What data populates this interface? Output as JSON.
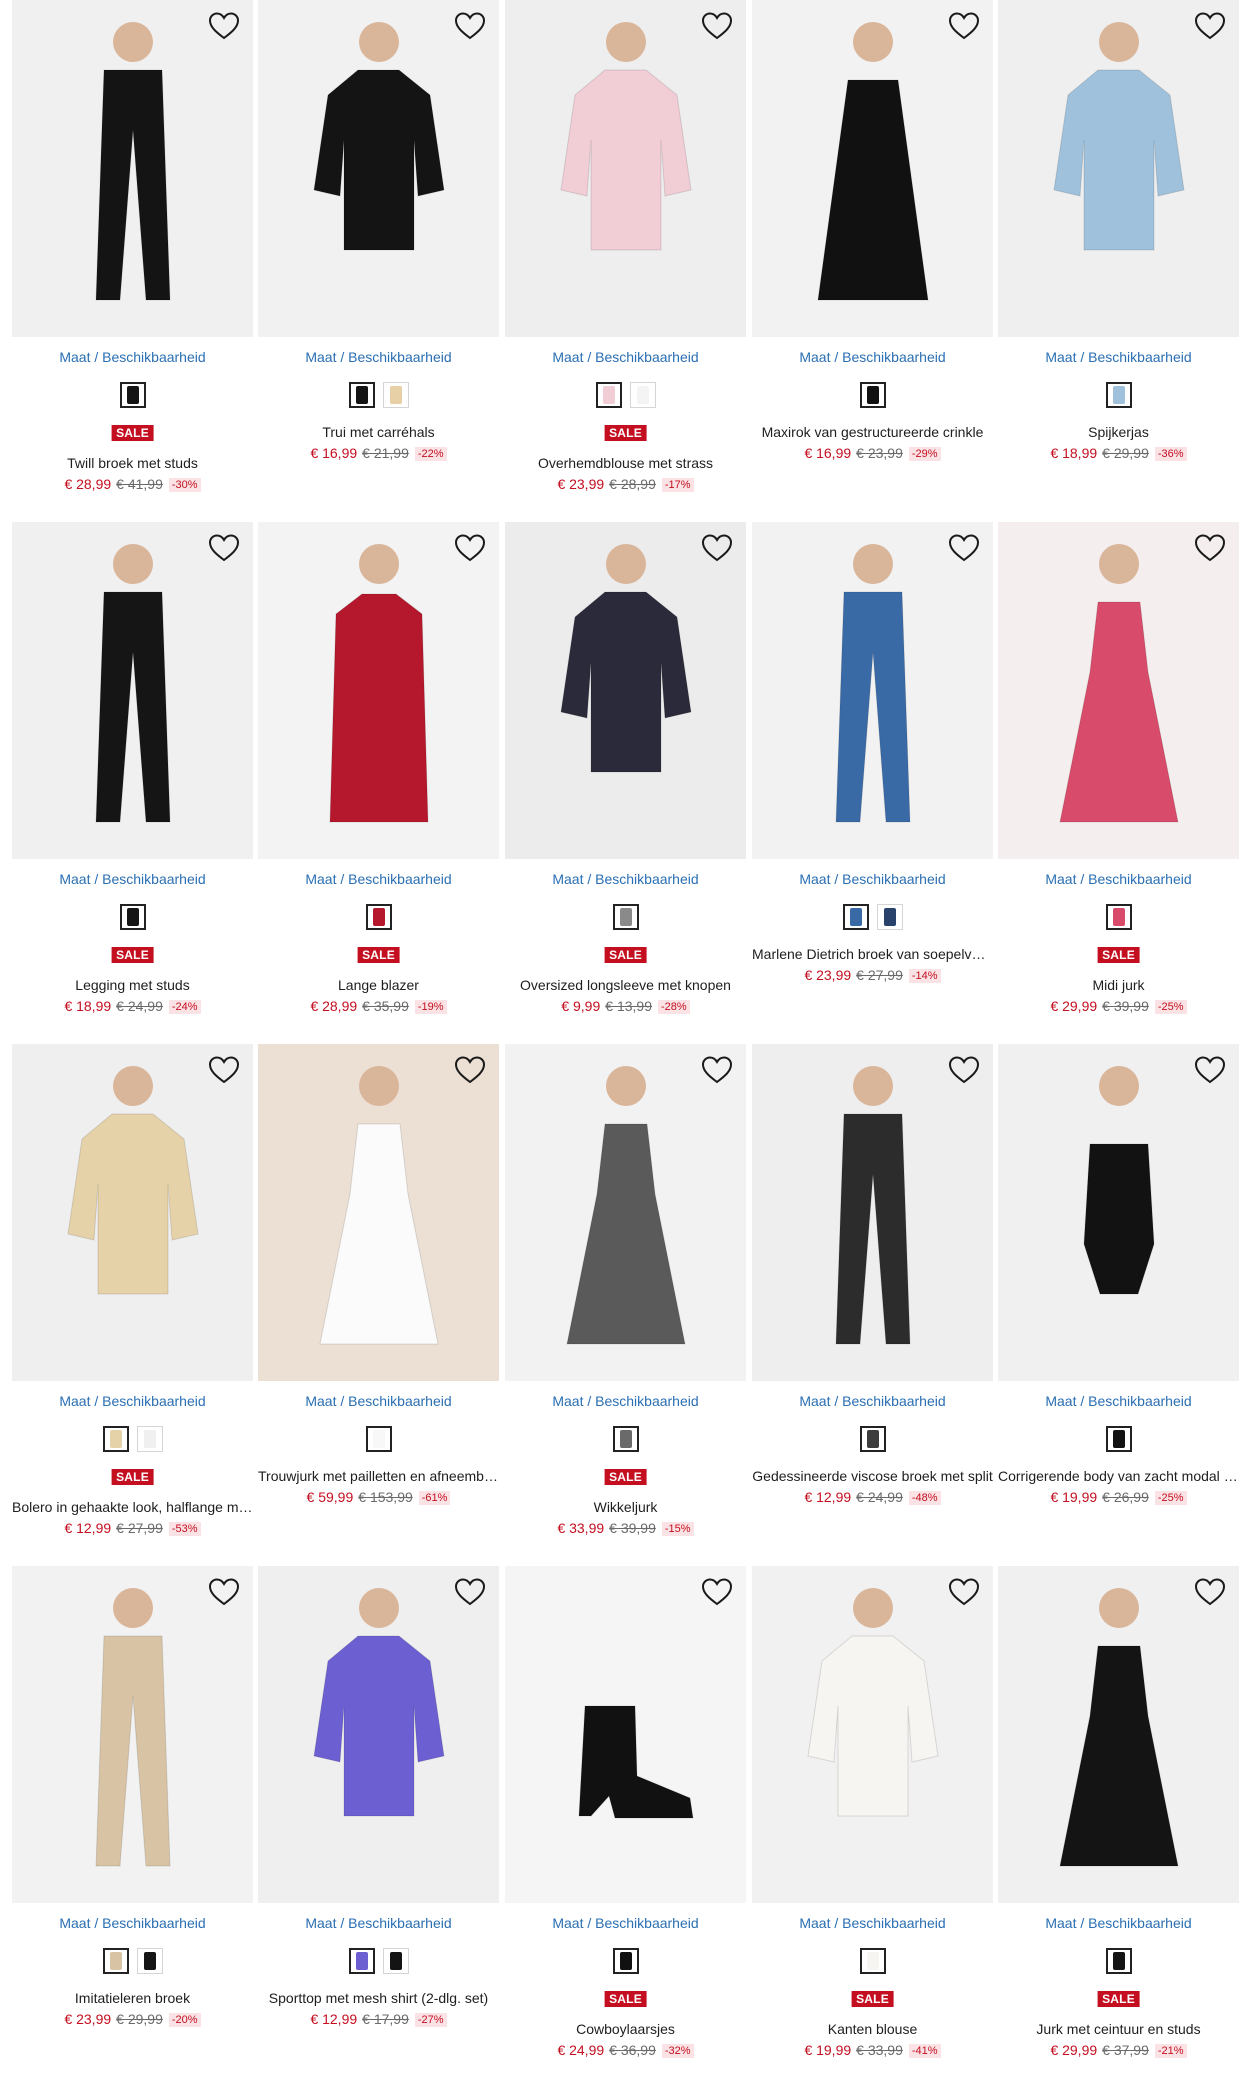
{
  "size_link_label": "Maat / Beschikbaarheid",
  "sale_label": "SALE",
  "favorite_icon": "heart-outline-icon",
  "colors": {
    "accent_link": "#2a6fb3",
    "sale_red": "#c40f20",
    "discount_bg": "#fbe3e5"
  },
  "products": [
    {
      "title": "Twill broek met studs",
      "price": "€ 28,99",
      "old_price": "€ 41,99",
      "discount": "-30%",
      "sale": true,
      "bg": "#f0f0f0",
      "garment": "#141414",
      "shape": "pants",
      "swatches": [
        "#141414"
      ]
    },
    {
      "title": "Trui met carréhals",
      "price": "€ 16,99",
      "old_price": "€ 21,99",
      "discount": "-22%",
      "sale": false,
      "bg": "#f1f1f1",
      "garment": "#141414",
      "shape": "top",
      "swatches": [
        "#141414",
        "#e7cfa6"
      ]
    },
    {
      "title": "Overhemdblouse met strass",
      "price": "€ 23,99",
      "old_price": "€ 28,99",
      "discount": "-17%",
      "sale": true,
      "bg": "#eeeeee",
      "garment": "#f1cdd6",
      "shape": "top",
      "swatches": [
        "#f1cdd6",
        "#f4f4f4"
      ]
    },
    {
      "title": "Maxirok van gestructureerde crinkle",
      "price": "€ 16,99",
      "old_price": "€ 23,99",
      "discount": "-29%",
      "sale": false,
      "bg": "#f2f2f2",
      "garment": "#111111",
      "shape": "skirt",
      "swatches": [
        "#111111"
      ]
    },
    {
      "title": "Spijkerjas",
      "price": "€ 18,99",
      "old_price": "€ 29,99",
      "discount": "-36%",
      "sale": false,
      "bg": "#efefef",
      "garment": "#9fc1dc",
      "shape": "top",
      "swatches": [
        "#9fc1dc"
      ]
    },
    {
      "title": "Legging met studs",
      "price": "€ 18,99",
      "old_price": "€ 24,99",
      "discount": "-24%",
      "sale": true,
      "bg": "#f0f0f0",
      "garment": "#151515",
      "shape": "pants",
      "swatches": [
        "#151515"
      ]
    },
    {
      "title": "Lange blazer",
      "price": "€ 28,99",
      "old_price": "€ 35,99",
      "discount": "-19%",
      "sale": true,
      "bg": "#f3f3f3",
      "garment": "#b5182c",
      "shape": "coat",
      "swatches": [
        "#b5182c"
      ]
    },
    {
      "title": "Oversized longsleeve met knopen",
      "price": "€ 9,99",
      "old_price": "€ 13,99",
      "discount": "-28%",
      "sale": true,
      "bg": "#ececec",
      "garment": "#2a2a3a",
      "shape": "top",
      "swatches": [
        "#8a8a8a"
      ]
    },
    {
      "title": "Marlene Dietrich broek van soepelvallende denim",
      "price": "€ 23,99",
      "old_price": "€ 27,99",
      "discount": "-14%",
      "sale": false,
      "bg": "#f2f2f2",
      "garment": "#3a6aa6",
      "shape": "pants",
      "swatches": [
        "#3a6aa6",
        "#28426c"
      ]
    },
    {
      "title": "Midi jurk",
      "price": "€ 29,99",
      "old_price": "€ 39,99",
      "discount": "-25%",
      "sale": true,
      "bg": "#f4eeee",
      "garment": "#d84b6a",
      "shape": "dress",
      "swatches": [
        "#d84b6a"
      ]
    },
    {
      "title": "Bolero in gehaakte look, halflange mouwen",
      "price": "€ 12,99",
      "old_price": "€ 27,99",
      "discount": "-53%",
      "sale": true,
      "bg": "#efefef",
      "garment": "#e6d2a9",
      "shape": "top",
      "swatches": [
        "#e6d2a9",
        "#f0f0f0"
      ]
    },
    {
      "title": "Trouwjurk met pailletten en afneembare rok",
      "price": "€ 59,99",
      "old_price": "€ 153,99",
      "discount": "-61%",
      "sale": false,
      "bg": "#ecdfd3",
      "garment": "#fbfbfb",
      "shape": "dress",
      "swatches": [
        "#f8f8f8"
      ]
    },
    {
      "title": "Wikkeljurk",
      "price": "€ 33,99",
      "old_price": "€ 39,99",
      "discount": "-15%",
      "sale": true,
      "bg": "#f2f2f2",
      "garment": "#5a5a5a",
      "shape": "dress",
      "swatches": [
        "#6a6a6a"
      ]
    },
    {
      "title": "Gedessineerde viscose broek met split",
      "price": "€ 12,99",
      "old_price": "€ 24,99",
      "discount": "-48%",
      "sale": false,
      "bg": "#eeeeee",
      "garment": "#2c2c2c",
      "shape": "pants",
      "swatches": [
        "#3c3c3c"
      ]
    },
    {
      "title": "Corrigerende body van zacht modal met kant",
      "price": "€ 19,99",
      "old_price": "€ 26,99",
      "discount": "-25%",
      "sale": false,
      "bg": "#f0f0f0",
      "garment": "#121212",
      "shape": "body",
      "swatches": [
        "#121212"
      ]
    },
    {
      "title": "Imitatieleren broek",
      "price": "€ 23,99",
      "old_price": "€ 29,99",
      "discount": "-20%",
      "sale": false,
      "bg": "#f2f2f2",
      "garment": "#d8c4a5",
      "shape": "pants",
      "swatches": [
        "#d8c4a5",
        "#151515"
      ]
    },
    {
      "title": "Sporttop met mesh shirt (2-dlg. set)",
      "price": "€ 12,99",
      "old_price": "€ 17,99",
      "discount": "-27%",
      "sale": false,
      "bg": "#efefef",
      "garment": "#6b5fd2",
      "shape": "top",
      "swatches": [
        "#6b5fd2",
        "#141414"
      ]
    },
    {
      "title": "Cowboylaarsjes",
      "price": "€ 24,99",
      "old_price": "€ 36,99",
      "discount": "-32%",
      "sale": true,
      "bg": "#f5f5f5",
      "garment": "#111111",
      "shape": "boot",
      "swatches": [
        "#111111"
      ]
    },
    {
      "title": "Kanten blouse",
      "price": "€ 19,99",
      "old_price": "€ 33,99",
      "discount": "-41%",
      "sale": true,
      "bg": "#f1f1f1",
      "garment": "#f7f5f1",
      "shape": "top",
      "swatches": [
        "#f7f5f1"
      ]
    },
    {
      "title": "Jurk met ceintuur en studs",
      "price": "€ 29,99",
      "old_price": "€ 37,99",
      "discount": "-21%",
      "sale": true,
      "bg": "#f0f0f0",
      "garment": "#141414",
      "shape": "dress",
      "swatches": [
        "#141414"
      ]
    }
  ]
}
